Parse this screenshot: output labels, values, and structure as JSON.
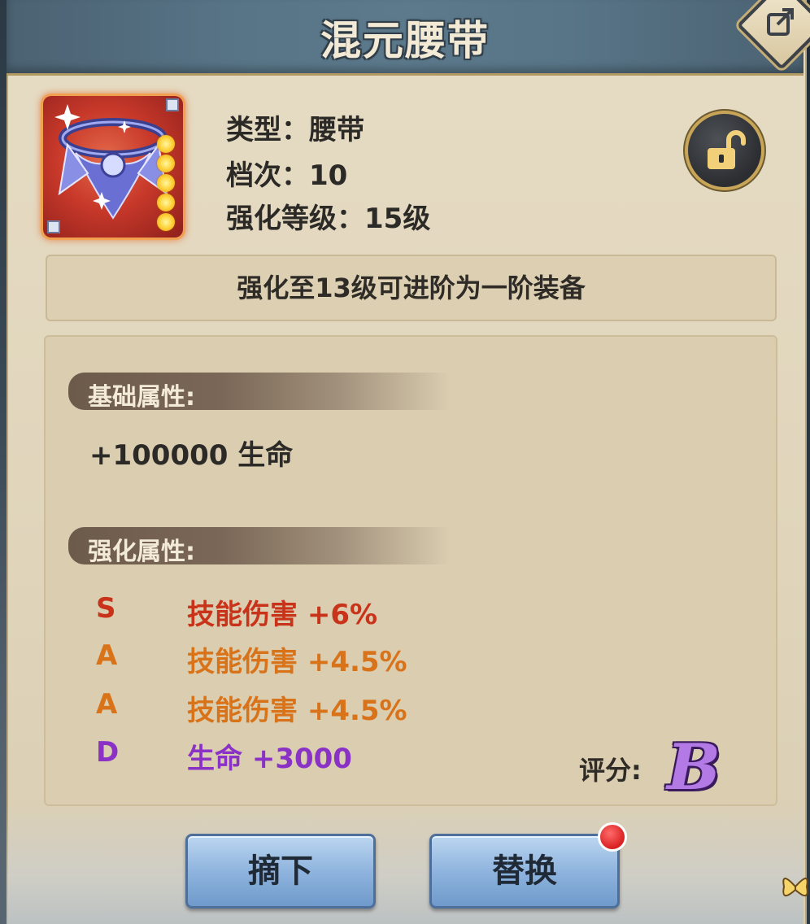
{
  "header": {
    "title": "混元腰带",
    "share_icon": "share-icon"
  },
  "item": {
    "icon": "belt-item-icon",
    "star_count": 5,
    "type_label": "类型：",
    "type_value": "腰带",
    "tier_label": "档次：",
    "tier_value": "10",
    "enhance_label": "强化等级：",
    "enhance_value": "15级",
    "lock_icon": "unlock-icon"
  },
  "notice": {
    "text": "强化至13级可进阶为一阶装备"
  },
  "base_attributes": {
    "title": "基础属性:",
    "values": [
      "+100000  生命"
    ]
  },
  "enhance_attributes": {
    "title": "强化属性:",
    "rows": [
      {
        "grade": "S",
        "text": "技能伤害  +6%",
        "color": "#c8331a"
      },
      {
        "grade": "A",
        "text": "技能伤害  +4.5%",
        "color": "#d9731a"
      },
      {
        "grade": "A",
        "text": "技能伤害  +4.5%",
        "color": "#d9731a"
      },
      {
        "grade": "D",
        "text": "生命  +3000",
        "color": "#8a31c6"
      }
    ]
  },
  "score": {
    "label": "评分:",
    "grade": "B"
  },
  "buttons": {
    "unequip": "摘下",
    "replace": "替换"
  },
  "colors": {
    "header": "#587587",
    "panel": "#e3d8bf",
    "button": "#8fb4de",
    "score_grade": "#b37ae6"
  }
}
